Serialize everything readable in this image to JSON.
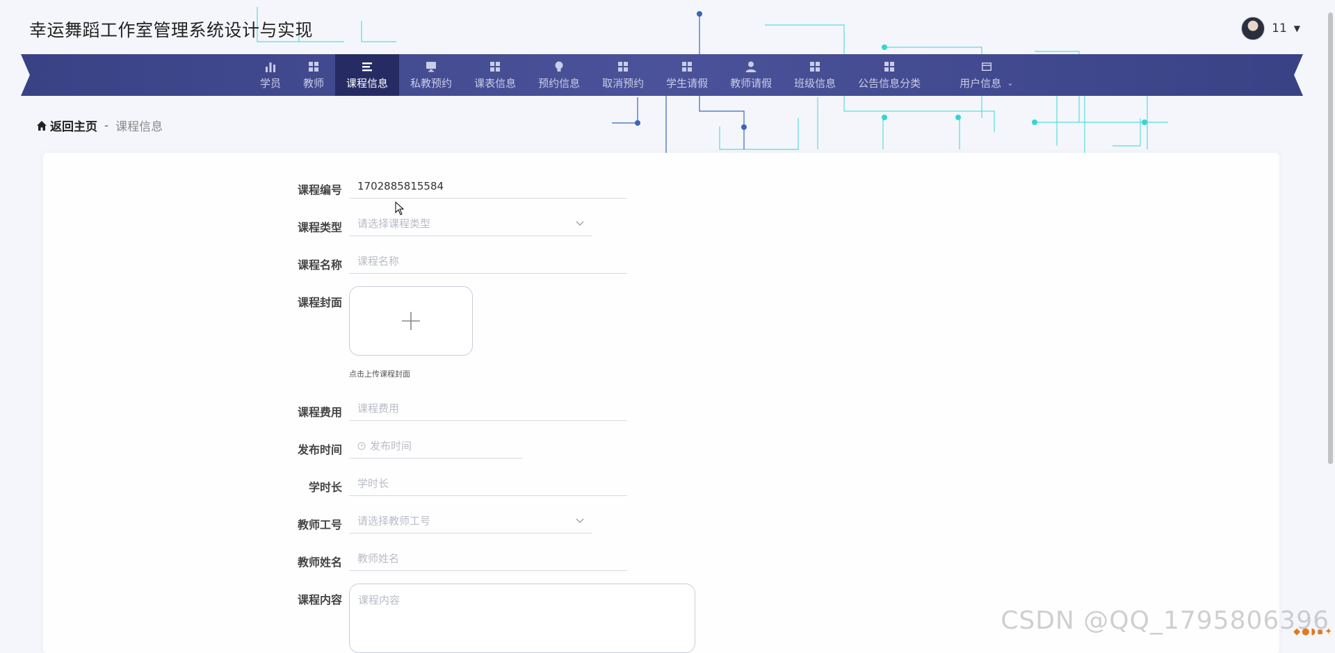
{
  "header": {
    "title": "幸运舞蹈工作室管理系统设计与实现",
    "user_name": "11"
  },
  "nav": {
    "items": [
      {
        "label": "学员",
        "icon": "bar-chart-icon"
      },
      {
        "label": "教师",
        "icon": "grid-icon"
      },
      {
        "label": "课程信息",
        "icon": "list-icon",
        "active": true
      },
      {
        "label": "私教预约",
        "icon": "monitor-icon"
      },
      {
        "label": "课表信息",
        "icon": "grid-icon"
      },
      {
        "label": "预约信息",
        "icon": "bulb-icon"
      },
      {
        "label": "取消预约",
        "icon": "grid-icon"
      },
      {
        "label": "学生请假",
        "icon": "grid-icon"
      },
      {
        "label": "教师请假",
        "icon": "user-icon"
      },
      {
        "label": "班级信息",
        "icon": "grid-icon"
      },
      {
        "label": "公告信息分类",
        "icon": "grid-icon"
      },
      {
        "label": "用户信息",
        "icon": "card-icon"
      }
    ]
  },
  "breadcrumb": {
    "home": "返回主页",
    "separator": "-",
    "current": "课程信息"
  },
  "form": {
    "course_no": {
      "label": "课程编号",
      "value": "1702885815584"
    },
    "course_type": {
      "label": "课程类型",
      "placeholder": "请选择课程类型"
    },
    "course_name": {
      "label": "课程名称",
      "placeholder": "课程名称"
    },
    "cover": {
      "label": "课程封面",
      "hint": "点击上传课程封面"
    },
    "fee": {
      "label": "课程费用",
      "placeholder": "课程费用"
    },
    "publish_time": {
      "label": "发布时间",
      "placeholder": "发布时间"
    },
    "hours": {
      "label": "学时长",
      "placeholder": "学时长"
    },
    "teacher_no": {
      "label": "教师工号",
      "placeholder": "请选择教师工号"
    },
    "teacher_name": {
      "label": "教师姓名",
      "placeholder": "教师姓名"
    },
    "content": {
      "label": "课程内容",
      "placeholder": "课程内容"
    }
  },
  "watermark": "CSDN @QQ_1795806396",
  "colors": {
    "nav_bg": "#434a92",
    "nav_active": "#262c63",
    "circuit_teal": "#33d6d6",
    "circuit_blue": "#3a66b8"
  }
}
